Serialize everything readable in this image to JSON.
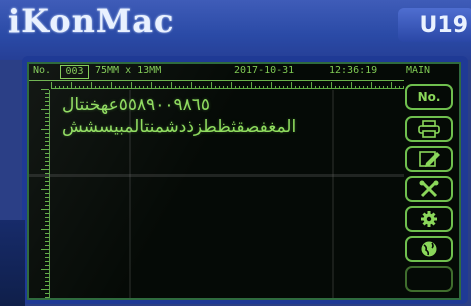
{
  "device": {
    "brand": "iKonMac",
    "model": "U19"
  },
  "status": {
    "no_label": "No.",
    "number": "003",
    "size": "75MM x 13MM",
    "date": "2017-10-31",
    "time": "12:36:19",
    "mode": "MAIN"
  },
  "message": {
    "line1": "٥٥٨٩٠٠٩٨٦٥عهخنتال",
    "line2": "المغفصقثظطزذدشمنتالمبيسشش"
  },
  "side_buttons": {
    "no_label": "No.",
    "icons": [
      "printer-icon",
      "edit-icon",
      "tools-icon",
      "gear-icon",
      "globe-icon",
      "blank"
    ]
  },
  "colors": {
    "screen_green": "#8fdc5e",
    "screen_bg": "#050a06",
    "device_blue": "#2a4aa6"
  }
}
